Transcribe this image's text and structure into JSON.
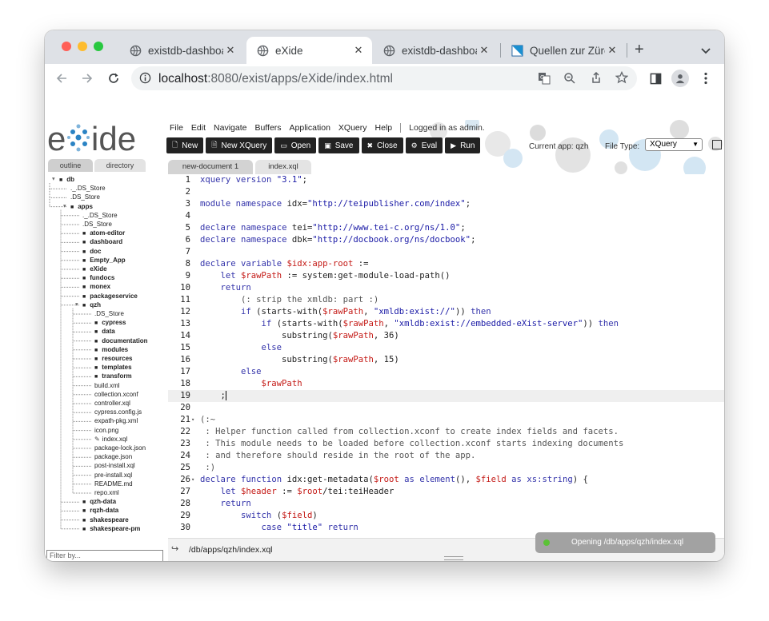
{
  "browser": {
    "tabs": [
      {
        "title": "existdb-dashboa",
        "active": false
      },
      {
        "title": "eXide",
        "active": true
      },
      {
        "title": "existdb-dashboa",
        "active": false
      },
      {
        "title": "Quellen zur Zürc",
        "active": false
      }
    ],
    "url_host": "localhost",
    "url_rest": ":8080/exist/apps/eXide/index.html"
  },
  "menu": [
    "File",
    "Edit",
    "Navigate",
    "Buffers",
    "Application",
    "XQuery",
    "Help"
  ],
  "logged_in": "Logged in as admin.",
  "toolbar": [
    {
      "label": "New",
      "icon": "new-doc-icon"
    },
    {
      "label": "New XQuery",
      "icon": "new-xquery-icon"
    },
    {
      "label": "Open",
      "icon": "folder-open-icon"
    },
    {
      "label": "Save",
      "icon": "save-icon"
    },
    {
      "label": "Close",
      "icon": "close-icon"
    },
    {
      "label": "Eval",
      "icon": "eval-icon"
    },
    {
      "label": "Run",
      "icon": "run-icon"
    }
  ],
  "current_app": "Current app: qzh",
  "file_type_label": "File Type:",
  "file_type_value": "XQuery",
  "sidebar_tabs": [
    "outline",
    "directory"
  ],
  "editor_tabs": [
    "new-document 1",
    "index.xql"
  ],
  "tree": [
    {
      "label": "db",
      "bold": true,
      "depth": 0
    },
    {
      "label": "._.DS_Store",
      "bold": false,
      "depth": 1
    },
    {
      "label": ".DS_Store",
      "bold": false,
      "depth": 1
    },
    {
      "label": "apps",
      "bold": true,
      "depth": 1
    },
    {
      "label": "._.DS_Store",
      "bold": false,
      "depth": 2
    },
    {
      "label": ".DS_Store",
      "bold": false,
      "depth": 2
    },
    {
      "label": "atom-editor",
      "bold": true,
      "depth": 2
    },
    {
      "label": "dashboard",
      "bold": true,
      "depth": 2
    },
    {
      "label": "doc",
      "bold": true,
      "depth": 2
    },
    {
      "label": "Empty_App",
      "bold": true,
      "depth": 2
    },
    {
      "label": "eXide",
      "bold": true,
      "depth": 2
    },
    {
      "label": "fundocs",
      "bold": true,
      "depth": 2
    },
    {
      "label": "monex",
      "bold": true,
      "depth": 2
    },
    {
      "label": "packageservice",
      "bold": true,
      "depth": 2
    },
    {
      "label": "qzh",
      "bold": true,
      "depth": 2
    },
    {
      "label": ".DS_Store",
      "bold": false,
      "depth": 3
    },
    {
      "label": "cypress",
      "bold": true,
      "depth": 3
    },
    {
      "label": "data",
      "bold": true,
      "depth": 3
    },
    {
      "label": "documentation",
      "bold": true,
      "depth": 3
    },
    {
      "label": "modules",
      "bold": true,
      "depth": 3
    },
    {
      "label": "resources",
      "bold": true,
      "depth": 3
    },
    {
      "label": "templates",
      "bold": true,
      "depth": 3
    },
    {
      "label": "transform",
      "bold": true,
      "depth": 3
    },
    {
      "label": "build.xml",
      "bold": false,
      "depth": 3
    },
    {
      "label": "collection.xconf",
      "bold": false,
      "depth": 3
    },
    {
      "label": "controller.xql",
      "bold": false,
      "depth": 3
    },
    {
      "label": "cypress.config.js",
      "bold": false,
      "depth": 3
    },
    {
      "label": "expath-pkg.xml",
      "bold": false,
      "depth": 3
    },
    {
      "label": "icon.png",
      "bold": false,
      "depth": 3
    },
    {
      "label": "index.xql",
      "bold": false,
      "depth": 3
    },
    {
      "label": "package-lock.json",
      "bold": false,
      "depth": 3
    },
    {
      "label": "package.json",
      "bold": false,
      "depth": 3
    },
    {
      "label": "post-install.xql",
      "bold": false,
      "depth": 3
    },
    {
      "label": "pre-install.xql",
      "bold": false,
      "depth": 3
    },
    {
      "label": "README.md",
      "bold": false,
      "depth": 3
    },
    {
      "label": "repo.xml",
      "bold": false,
      "depth": 3
    },
    {
      "label": "qzh-data",
      "bold": true,
      "depth": 2
    },
    {
      "label": "rqzh-data",
      "bold": true,
      "depth": 2
    },
    {
      "label": "shakespeare",
      "bold": true,
      "depth": 2
    },
    {
      "label": "shakespeare-pm",
      "bold": true,
      "depth": 2
    }
  ],
  "filter_placeholder": "Filter by...",
  "code_lines": [
    "xquery version \"3.1\";",
    "",
    "module namespace idx=\"http://teipublisher.com/index\";",
    "",
    "declare namespace tei=\"http://www.tei-c.org/ns/1.0\";",
    "declare namespace dbk=\"http://docbook.org/ns/docbook\";",
    "",
    "declare variable $idx:app-root :=",
    "    let $rawPath := system:get-module-load-path()",
    "    return",
    "        (: strip the xmldb: part :)",
    "        if (starts-with($rawPath, \"xmldb:exist://\")) then",
    "            if (starts-with($rawPath, \"xmldb:exist://embedded-eXist-server\")) then",
    "                substring($rawPath, 36)",
    "            else",
    "                substring($rawPath, 15)",
    "        else",
    "            $rawPath",
    "    ;",
    "",
    "(:~",
    " : Helper function called from collection.xconf to create index fields and facets.",
    " : This module needs to be loaded before collection.xconf starts indexing documents",
    " : and therefore should reside in the root of the app.",
    " :)",
    "declare function idx:get-metadata($root as element(), $field as xs:string) {",
    "    let $header := $root/tei:teiHeader",
    "    return",
    "        switch ($field)",
    "            case \"title\" return"
  ],
  "cursor_line": 19,
  "fold_lines": [
    21,
    26
  ],
  "status_path": "/db/apps/qzh/index.xql",
  "toast": "Opening /db/apps/qzh/index.xql"
}
